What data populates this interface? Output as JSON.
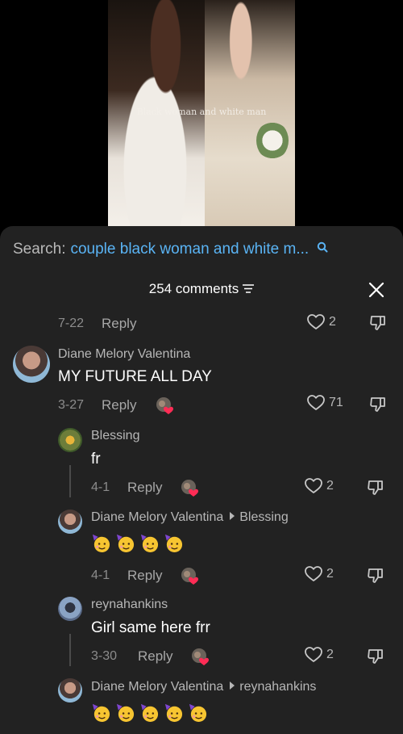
{
  "video": {
    "caption": "Black woman and white man"
  },
  "search": {
    "label": "Search:",
    "query": "couple black woman and white m..."
  },
  "comments_header": {
    "title": "254 comments"
  },
  "colors": {
    "sheet_bg": "#222222",
    "search_query": "#5ab4f5",
    "heart_badge": "#fe2c55"
  },
  "partial_comment": {
    "date": "7-22",
    "reply_label": "Reply",
    "likes": "2"
  },
  "comments": [
    {
      "username": "Diane Melory Valentina",
      "text": "MY FUTURE ALL DAY",
      "date": "3-27",
      "reply_label": "Reply",
      "likes": "71",
      "liked_by_creator": true
    }
  ],
  "replies": [
    {
      "username": "Blessing",
      "text": "fr",
      "date": "4-1",
      "reply_label": "Reply",
      "likes": "2",
      "liked_by_creator": true
    },
    {
      "username": "Diane Melory Valentina",
      "reply_to": "Blessing",
      "text": "🥳🥳🥳🥳",
      "date": "4-1",
      "reply_label": "Reply",
      "likes": "2",
      "liked_by_creator": true
    },
    {
      "username": "reynahankins",
      "text": "Girl same here frr",
      "date": "3-30",
      "reply_label": "Reply",
      "likes": "2",
      "liked_by_creator": true
    },
    {
      "username": "Diane Melory Valentina",
      "reply_to": "reynahankins",
      "text": "🥳🥳🥳🥳🥳"
    }
  ]
}
